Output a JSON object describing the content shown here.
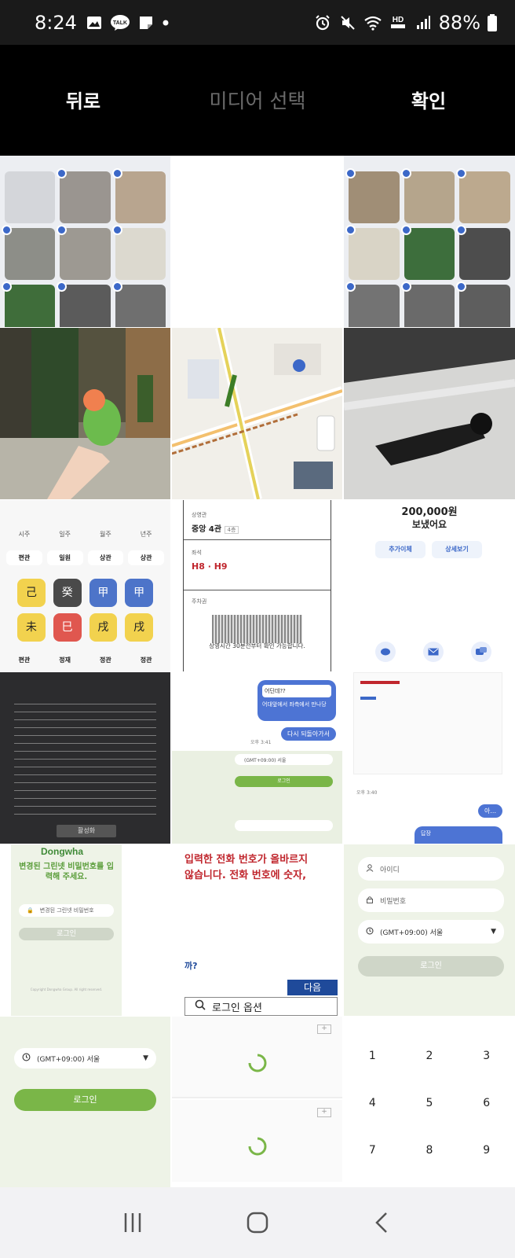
{
  "status_bar": {
    "time": "8:24",
    "battery": "88%",
    "talk_badge": "TALK",
    "hd_label": "HD"
  },
  "topbar": {
    "back_label": "뒤로",
    "title": "미디어 선택",
    "confirm_label": "확인"
  },
  "thumbnails": {
    "row3_col1": {
      "headers": [
        "시주",
        "일주",
        "월주",
        "년주"
      ],
      "row1": [
        "편관",
        "일원",
        "상관",
        "상관"
      ],
      "stems": [
        "己",
        "癸",
        "甲",
        "甲"
      ],
      "branches": [
        "未",
        "巳",
        "戌",
        "戌"
      ],
      "row2": [
        "편관",
        "정재",
        "정관",
        "정관"
      ]
    },
    "row3_col2": {
      "label1": "상영관",
      "value1": "중앙 4관",
      "badge1": "4층",
      "label2": "좌석",
      "value2": "H8 · H9",
      "label3": "주차권",
      "notice": "상영시간 30분전부터 확인 가능합니다."
    },
    "row3_col3": {
      "amount": "200,000원",
      "sent": "보냈어요",
      "btn1": "추가이체",
      "btn2": "상세보기"
    },
    "row4_col1": {
      "button": "활성화"
    },
    "row4_col2": {
      "chat1": "어딘데??",
      "chat2": "어대앞에서 좌측에서 만나당",
      "chat3": "다시 되돌아가서",
      "time": "오후 3:41",
      "timezone": "(GMT+09:00) 서울",
      "login": "로그인"
    },
    "row4_col3": {
      "time": "오후 3:40",
      "bubble": "아...",
      "bubble2": "답장"
    },
    "row5_col1": {
      "brand": "Dongwha",
      "heading": "변경된 그린넷 비밀번호를 입력해 주세요.",
      "placeholder": "변경된 그린넷 비밀번호",
      "button": "로그인",
      "copyright": "Copyright Dongwha Group. All right reserved."
    },
    "row5_col2": {
      "error_line1": "입력한 전화 번호가 올바르지",
      "error_line2": "않습니다. 전화 번호에 숫자,",
      "question": "까?",
      "next": "다음",
      "login_options": "로그인 옵션"
    },
    "row5_col3": {
      "id_placeholder": "아이디",
      "pw_placeholder": "비밀번호",
      "timezone": "(GMT+09:00) 서울",
      "login": "로그인"
    },
    "row6_col1": {
      "timezone": "(GMT+09:00) 서울",
      "login": "로그인"
    },
    "row6_col3": {
      "keys": [
        "1",
        "2",
        "3",
        "4",
        "5",
        "6",
        "7",
        "8",
        "9"
      ]
    }
  },
  "colors": {
    "accent_blue": "#3c68c8",
    "green": "#7ab648",
    "error_red": "#c0262d"
  }
}
